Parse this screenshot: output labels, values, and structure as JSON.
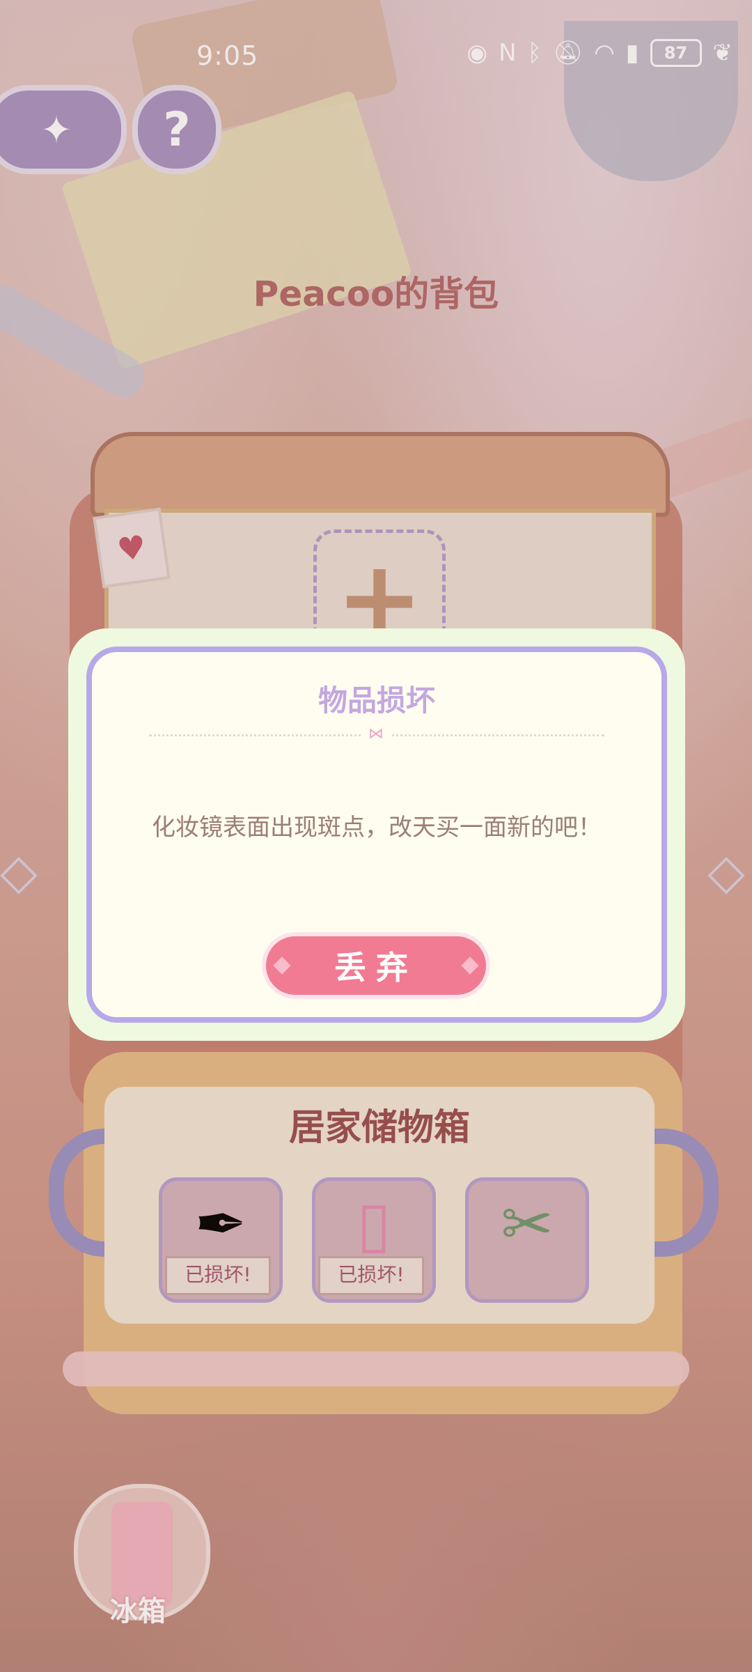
{
  "status_bar": {
    "time": "9:05",
    "battery": "87",
    "icons": [
      "eye-icon",
      "nfc-icon",
      "bluetooth-icon",
      "mute-icon",
      "wifi-icon",
      "signal-4g-icon",
      "battery-icon",
      "leaf-icon"
    ]
  },
  "top_controls": {
    "back_icon": "compass-star-icon",
    "help_label": "?"
  },
  "bag": {
    "title": "Peacoo的背包",
    "plus_label": "+"
  },
  "dialog": {
    "title": "物品损坏",
    "message": "化妆镜表面出现斑点，改天买一面新的吧！",
    "discard_label": "丢弃"
  },
  "storage": {
    "title": "居家储物箱",
    "items": [
      {
        "icon": "quill-ink-icon",
        "badge": "已损坏!"
      },
      {
        "icon": "mirror-icon",
        "badge": "已损坏!"
      },
      {
        "icon": "scissors-icon",
        "badge": ""
      }
    ]
  },
  "fridge": {
    "label": "冰箱"
  },
  "colors": {
    "accent_pink": "#f17b92",
    "dialog_border": "#b7a8ea",
    "title_purple": "#c3a7e0"
  }
}
